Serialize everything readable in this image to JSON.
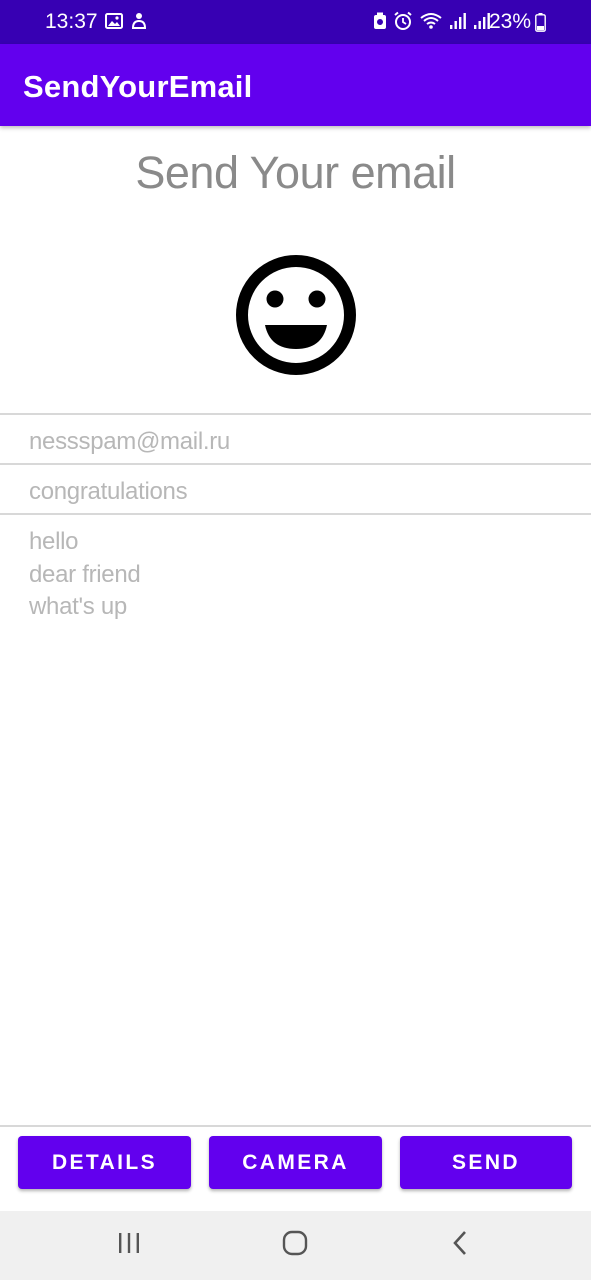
{
  "status_bar": {
    "time": "13:37",
    "battery_percent": "23%",
    "background_color": "#3700b3",
    "left_icons": [
      "image-icon",
      "notification-icon"
    ],
    "right_icons": [
      "battery-saver-icon",
      "alarm-icon",
      "wifi-icon",
      "signal-icon",
      "signal-icon",
      "battery-icon"
    ]
  },
  "app_bar": {
    "title": "SendYourEmail",
    "color": "#6200ee"
  },
  "main": {
    "heading": "Send Your email",
    "image_icon": "smiley-face-icon",
    "recipient": "nessspam@mail.ru",
    "subject": "congratulations",
    "message_lines": [
      "hello",
      "dear friend",
      "what's up"
    ]
  },
  "buttons": {
    "details": "DETAILS",
    "camera": "CAMERA",
    "send": "SEND"
  },
  "nav_bar": {
    "recents_icon": "recents-icon",
    "home_icon": "home-icon",
    "back_icon": "back-icon"
  }
}
